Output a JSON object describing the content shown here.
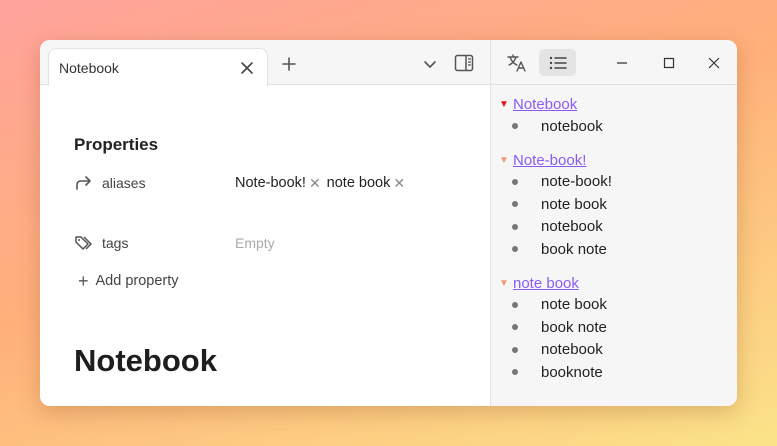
{
  "tab": {
    "title": "Notebook"
  },
  "properties": {
    "heading": "Properties",
    "aliases": {
      "name": "aliases",
      "values": [
        "Note-book!",
        "note book"
      ]
    },
    "tags": {
      "name": "tags",
      "placeholder": "Empty"
    },
    "add_label": "Add property"
  },
  "note": {
    "title": "Notebook"
  },
  "outline": {
    "groups": [
      {
        "label": "Notebook",
        "marker_color": "#e0101f",
        "items": [
          "notebook"
        ]
      },
      {
        "label": "Note-book!",
        "marker_color": "#f09a7a",
        "items": [
          "note-book!",
          "note book",
          "notebook",
          "book note"
        ]
      },
      {
        "label": "note book",
        "marker_color": "#f09a7a",
        "items": [
          "note book",
          "book note",
          "notebook",
          "booknote"
        ]
      }
    ]
  },
  "colors": {
    "link": "#8a5cf5",
    "active_marker": "#e0101f",
    "inactive_marker": "#f09a7a"
  }
}
